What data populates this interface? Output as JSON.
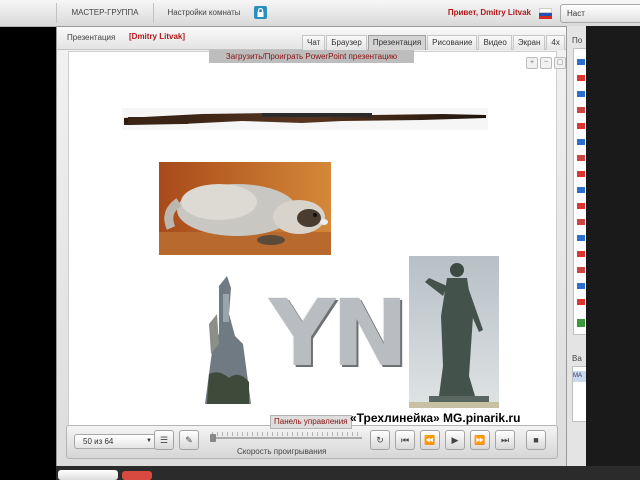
{
  "topbar": {
    "tab_master_group": "МАСТЕР-ГРУППА",
    "tab_room_settings": "Настройки комнаты",
    "greeting": "Привет, Dmitry Litvak",
    "right_button": "Наст"
  },
  "panel": {
    "title": "Презентация",
    "user_tag": "[Dmitry Litvak]",
    "tabs": [
      "Чат",
      "Браузер",
      "Презентация",
      "Рисование",
      "Видео",
      "Экран",
      "4x"
    ],
    "active_tab": "Презентация",
    "upload_label": "Загрузить/Проиграть PowerPoint презентацию"
  },
  "slide": {
    "big_letters": "YN"
  },
  "controls": {
    "page_indicator": "50 из 64",
    "control_panel_label": "Панель управления",
    "speed_label": "Скорость проигрывания"
  },
  "overlay": {
    "text": "«Трехлинейка»  MG.pinarik.ru"
  },
  "rpanel": {
    "head": "По",
    "head2": "Ва",
    "list2_item": "МА"
  },
  "colors": {
    "accent_red": "#b01818",
    "lock_blue": "#2a8fbe",
    "active_tab_bg": "#d4d4d4"
  }
}
